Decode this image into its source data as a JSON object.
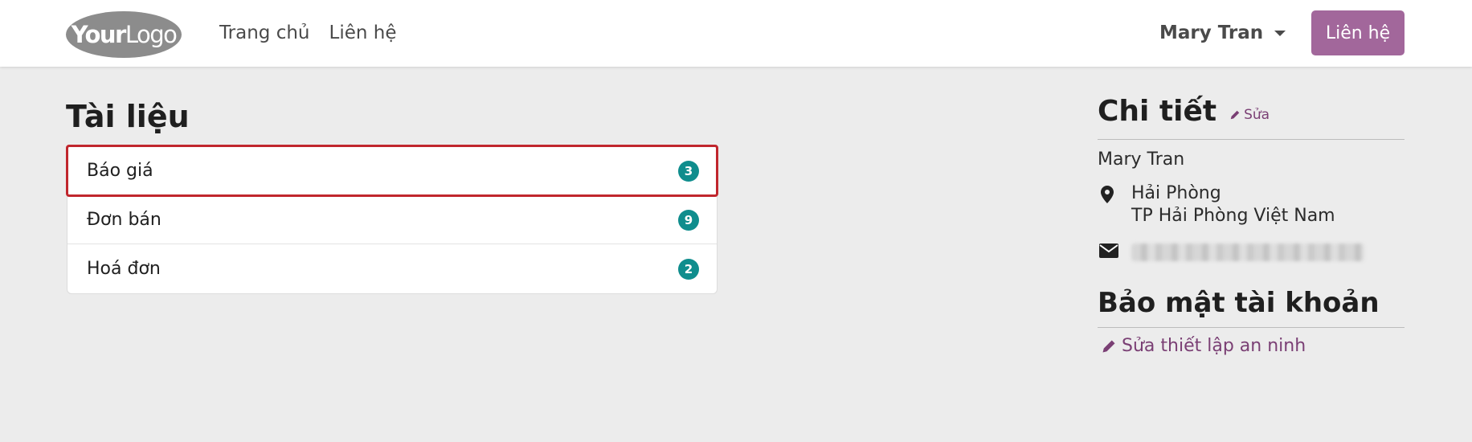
{
  "header": {
    "logo_text_bold": "Your",
    "logo_text_thin": "Logo",
    "nav": [
      "Trang chủ",
      "Liên hệ"
    ],
    "user_name": "Mary Tran",
    "contact_button": "Liên hệ",
    "accent_color": "#a2679b"
  },
  "documents": {
    "title": "Tài liệu",
    "items": [
      {
        "label": "Báo giá",
        "count": "3",
        "selected": true
      },
      {
        "label": "Đơn bán",
        "count": "9",
        "selected": false
      },
      {
        "label": "Hoá đơn",
        "count": "2",
        "selected": false
      }
    ],
    "badge_color": "#0f8d8d"
  },
  "details": {
    "title": "Chi tiết",
    "edit_label": "Sửa",
    "name": "Mary Tran",
    "address_line1": "Hải Phòng",
    "address_line2": "TP Hải Phòng Việt Nam",
    "email_icon": "envelope-icon",
    "pin_icon": "map-marker-icon"
  },
  "security": {
    "title": "Bảo mật tài khoản",
    "link_label": "Sửa thiết lập an ninh"
  }
}
